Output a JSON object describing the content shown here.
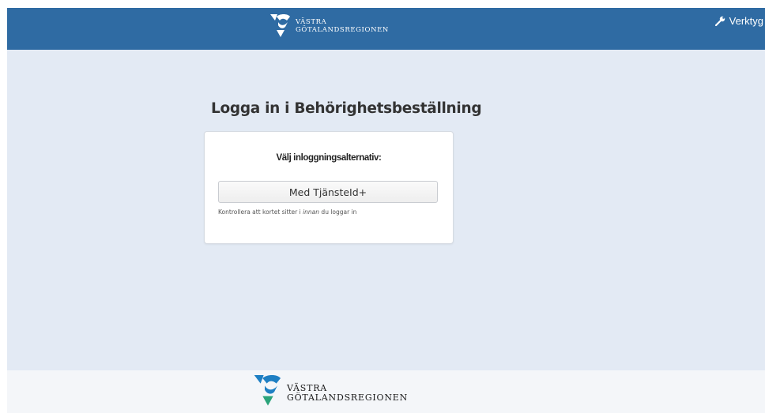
{
  "header": {
    "logo_line1": "VÄSTRA",
    "logo_line2": "GÖTALANDSREGIONEN",
    "tools_label": "Verktyg"
  },
  "main": {
    "title": "Logga in i Behörighetsbeställning",
    "card": {
      "subtitle": "Välj inloggningsalternativ:",
      "button_label": "Med TjänsteId+",
      "hint_before": "Kontrollera att kortet sitter i ",
      "hint_emphasis": "innan",
      "hint_after": " du loggar in"
    }
  },
  "footer": {
    "logo_line1": "VÄSTRA",
    "logo_line2": "GÖTALANDSREGIONEN"
  },
  "colors": {
    "header_bg": "#2f6ba3",
    "page_bg": "#e3eaf4",
    "logo_blue": "#1e7fc3",
    "logo_green": "#2aa37a"
  }
}
